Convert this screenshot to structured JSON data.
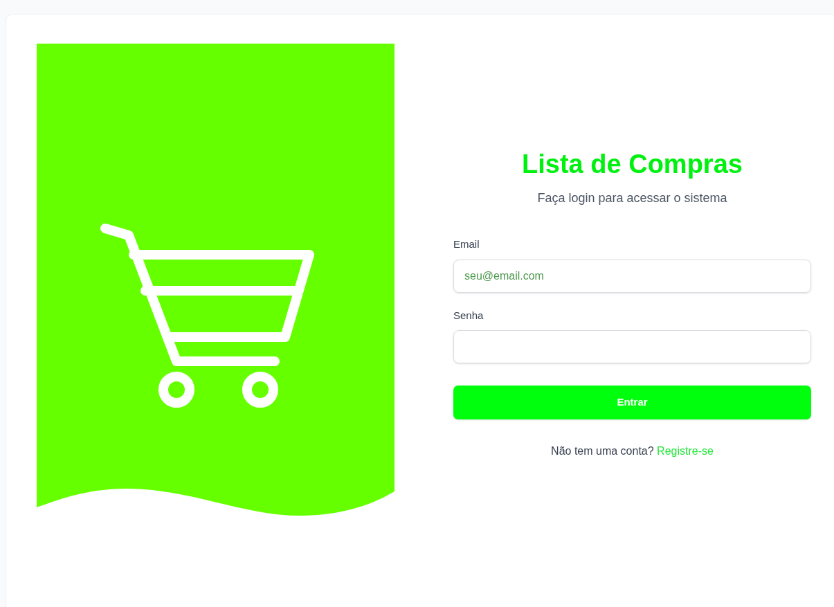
{
  "title": "Lista de Compras",
  "subtitle": "Faça login para acessar o sistema",
  "fields": [
    {
      "label": "Email",
      "placeholder": "seu@email.com"
    },
    {
      "label": "Senha"
    }
  ],
  "submit": "Entrar",
  "footer": {
    "text": "Não tem uma conta?",
    "link": "Registre-se"
  }
}
